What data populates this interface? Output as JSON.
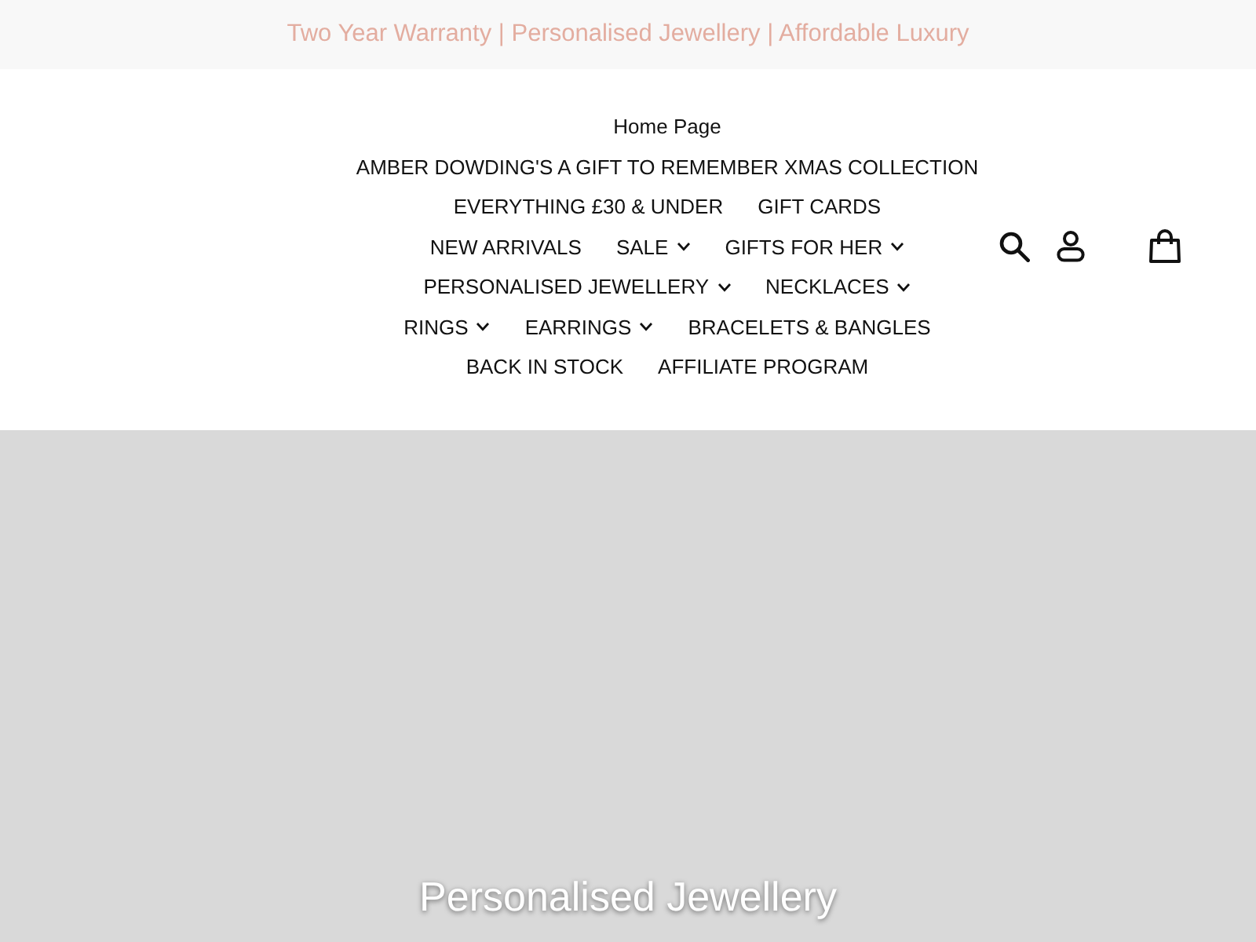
{
  "announcement": {
    "text": "Two Year Warranty | Personalised Jewellery | Affordable Luxury"
  },
  "nav": [
    {
      "label": "Home Page",
      "has_dropdown": false
    },
    {
      "label": "AMBER DOWDING'S A GIFT TO REMEMBER XMAS COLLECTION",
      "has_dropdown": false
    },
    {
      "label": "EVERYTHING £30 & UNDER",
      "has_dropdown": false
    },
    {
      "label": "GIFT CARDS",
      "has_dropdown": false
    },
    {
      "label": "NEW ARRIVALS",
      "has_dropdown": false
    },
    {
      "label": "SALE",
      "has_dropdown": true
    },
    {
      "label": "GIFTS FOR HER",
      "has_dropdown": true
    },
    {
      "label": "PERSONALISED JEWELLERY",
      "has_dropdown": true
    },
    {
      "label": "NECKLACES",
      "has_dropdown": true
    },
    {
      "label": "RINGS",
      "has_dropdown": true
    },
    {
      "label": "EARRINGS",
      "has_dropdown": true
    },
    {
      "label": "BRACELETS & BANGLES",
      "has_dropdown": false
    },
    {
      "label": "BACK IN STOCK",
      "has_dropdown": false
    },
    {
      "label": "AFFILIATE PROGRAM",
      "has_dropdown": false
    }
  ],
  "hero": {
    "title": "Personalised Jewellery"
  }
}
